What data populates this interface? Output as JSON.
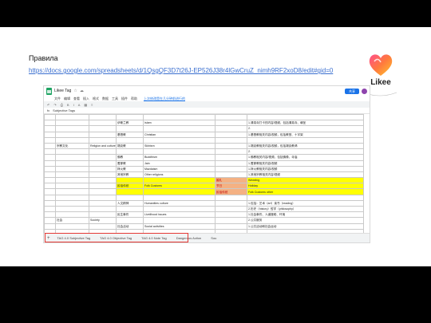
{
  "slide": {
    "title": "Правила",
    "link": "https://docs.google.com/spreadsheets/d/1QsgQF3D7t26J-EP526J38r4lGwCruZ_nimh9RF2xoD8/edit#gid=0",
    "logo_text": "Likee"
  },
  "colors": {
    "background": "#000000",
    "accent_red": "#e53935",
    "highlight_yellow": "#ffff00",
    "highlight_orange": "#f4b183",
    "sheets_green": "#1fa463"
  },
  "sheet": {
    "doc_title": "Likee Tag",
    "share_label": "共享",
    "menu": [
      "文件",
      "编辑",
      "查看",
      "插入",
      "格式",
      "数据",
      "工具",
      "插件",
      "帮助"
    ],
    "menu_note": "上次修改是在几分钟前进行的",
    "subtitle_cell": "Subjective Tags",
    "rows": [
      {
        "c1": "",
        "c2": "",
        "c3": "",
        "c4": "",
        "c5": "",
        "c6": "",
        "c7": ""
      },
      {
        "c1": "",
        "c2": "",
        "c3": "",
        "c4": "伊斯兰教",
        "c5": "Islam",
        "c6": "",
        "c7": "1.清真寺打卡的内容/视频，包括清真寺、朝圣"
      },
      {
        "c1": "",
        "c2": "",
        "c3": "",
        "c4": "",
        "c5": "",
        "c6": "",
        "c7": "2."
      },
      {
        "c1": "",
        "c2": "",
        "c3": "",
        "c4": "基督教",
        "c5": "Christian",
        "c6": "",
        "c7": "1.基督教相关内容/视频，包括教堂、十字架"
      },
      {
        "c1": "",
        "c2": "",
        "c3": "",
        "c4": "",
        "c5": "",
        "c6": "",
        "c7": ""
      },
      {
        "c1": "",
        "c2": "宗教文化",
        "c3": "Religion and culture",
        "c4": "锡克教",
        "c5": "Sikhism",
        "c6": "",
        "c7": "1.锡克教相关内容/视频，包括锡克教谒"
      },
      {
        "c1": "",
        "c2": "",
        "c3": "",
        "c4": "",
        "c5": "",
        "c6": "",
        "c7": "2."
      },
      {
        "c1": "",
        "c2": "",
        "c3": "",
        "c4": "佛教",
        "c5": "Buddhism",
        "c6": "",
        "c7": "1.佛教相关内容/视频，包括佛像、寺庙"
      },
      {
        "c1": "",
        "c2": "",
        "c3": "",
        "c4": "耆那教",
        "c5": "Jain",
        "c6": "",
        "c7": "1.耆那教相关内容/视频"
      },
      {
        "c1": "",
        "c2": "",
        "c3": "",
        "c4": "拜火教",
        "c5": "Mazdaism",
        "c6": "",
        "c7": "1.拜火教相关内容/视频"
      },
      {
        "c1": "",
        "c2": "",
        "c3": "",
        "c4": "其他宗教",
        "c5": "Other religions",
        "c6": "",
        "c7": "1.其他宗教相关内容/视频"
      },
      {
        "c1": "",
        "c2": "",
        "c3": "",
        "c4": "",
        "c5": "",
        "c6": "婚礼",
        "c7": "Wedding"
      },
      {
        "c1": "",
        "c2": "",
        "c3": "",
        "c4": "民俗传统",
        "c5": "Folk Customs",
        "c6": "节日",
        "c7": "Holiday"
      },
      {
        "c1": "",
        "c2": "",
        "c3": "",
        "c4": "",
        "c5": "",
        "c6": "民俗传统",
        "c7": "Folk Customs other"
      },
      {
        "c1": "",
        "c2": "",
        "c3": "",
        "c4": "",
        "c5": "",
        "c6": "",
        "c7": ""
      },
      {
        "c1": "",
        "c2": "",
        "c3": "",
        "c4": "人文精神",
        "c5": "Humanities culture",
        "c6": "",
        "c7": "1.包括：艺术（art）读书（reading）"
      },
      {
        "c1": "",
        "c2": "",
        "c3": "",
        "c4": "",
        "c5": "",
        "c6": "",
        "c7": "2.历史（history）哲学（philosophy）"
      },
      {
        "c1": "",
        "c2": "",
        "c3": "",
        "c4": "民生事件",
        "c5": "Livelihood issues",
        "c6": "",
        "c7": "1.社会事件、人道援助、环境"
      },
      {
        "c1": "",
        "c2": "社会",
        "c3": "Society",
        "c4": "",
        "c5": "",
        "c6": "",
        "c7": "2.公共服务"
      },
      {
        "c1": "",
        "c2": "",
        "c3": "",
        "c4": "社会活动",
        "c5": "Social activities",
        "c6": "",
        "c7": "1.公共活动和社会运动"
      },
      {
        "c1": "",
        "c2": "",
        "c3": "",
        "c4": "",
        "c5": "",
        "c6": "",
        "c7": ""
      },
      {
        "c1": "",
        "c2": "",
        "c3": "",
        "c4": "政治新闻",
        "c5": "Political news",
        "c6": "",
        "c7": "1.政治相关新闻"
      },
      {
        "c1": "",
        "c2": "",
        "c3": "",
        "c4": "",
        "c5": "",
        "c6": "",
        "c7": ""
      },
      {
        "c1": "",
        "c2": "",
        "c3": "",
        "c4": "财经新闻",
        "c5": "Financial news",
        "c6": "",
        "c7": "1.股票基金"
      },
      {
        "c1": "",
        "c2": "",
        "c3": "",
        "c4": "天气预报",
        "c5": "Weather forecast",
        "c6": "",
        "c7": "1.天气预报"
      }
    ],
    "tabs": [
      "TAG 4.0 Subjective Tag",
      "TAG 4.0 Objective Tag",
      "TAG 4.0 Note Tag",
      "Dangerous Action",
      "Sou"
    ]
  }
}
